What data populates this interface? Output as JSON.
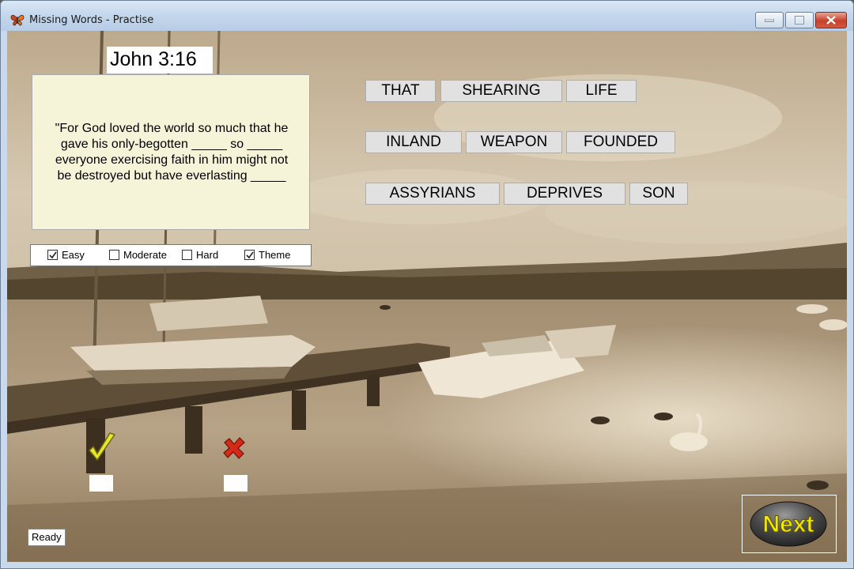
{
  "window": {
    "title": "Missing Words - Practise"
  },
  "verse": {
    "reference": "John 3:16",
    "lines": [
      "\"For God loved the world so much that he",
      "gave his only-begotten _____ so _____",
      "everyone exercising faith in him might not",
      "be destroyed but have everlasting _____"
    ]
  },
  "difficulty": [
    {
      "label": "Easy",
      "checked": true
    },
    {
      "label": "Moderate",
      "checked": false
    },
    {
      "label": "Hard",
      "checked": false
    },
    {
      "label": "Theme",
      "checked": true
    }
  ],
  "word_rows": [
    [
      "THAT",
      "SHEARING",
      "LIFE"
    ],
    [
      "INLAND",
      "WEAPON",
      "FOUNDED"
    ],
    [
      "ASSYRIANS",
      "DEPRIVES",
      "SON"
    ]
  ],
  "score": {
    "correct": "",
    "wrong": ""
  },
  "status": "Ready",
  "next_label": "Next",
  "icons": [
    "butterfly-app-icon",
    "check-icon",
    "cross-icon"
  ],
  "colors": {
    "next_text": "#f2e600",
    "next_button": "#4a4a4a",
    "title_bar": "#c3d6ec",
    "close_button": "#c7402b"
  }
}
